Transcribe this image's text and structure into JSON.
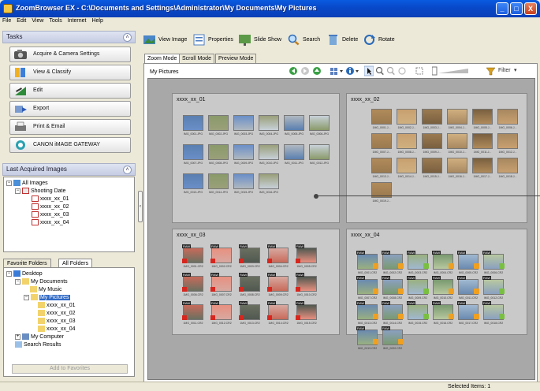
{
  "window": {
    "title": "ZoomBrowser EX  -  C:\\Documents and Settings\\Administrator\\My Documents\\My Pictures",
    "min": "_",
    "max": "□",
    "close": "X"
  },
  "menu": [
    "File",
    "Edit",
    "View",
    "Tools",
    "Internet",
    "Help"
  ],
  "tasks": {
    "header": "Tasks",
    "items": [
      "Acquire & Camera Settings",
      "View & Classify",
      "Edit",
      "Export",
      "Print & Email",
      "CANON iMAGE GATEWAY"
    ]
  },
  "last_acquired": {
    "header": "Last Acquired Images",
    "root": "All Images",
    "group": "Shooting Date",
    "folders": [
      "xxxx_xx_01",
      "xxxx_xx_02",
      "xxxx_xx_03",
      "xxxx_xx_04"
    ]
  },
  "favorites": {
    "tabs": [
      "Favorite Folders",
      "All Folders"
    ],
    "desktop": "Desktop",
    "my_documents": "My Documents",
    "my_music": "My Music",
    "my_pictures": "My Pictures",
    "folders": [
      "xxxx_xx_01",
      "xxxx_xx_02",
      "xxxx_xx_03",
      "xxxx_xx_04"
    ],
    "my_computer": "My Computer",
    "search_results": "Search Results",
    "add_button": "Add to Favorites"
  },
  "toolbar": [
    "View Image",
    "Properties",
    "Slide Show",
    "Search",
    "Delete",
    "Rotate"
  ],
  "view_tabs": [
    "Zoom Mode",
    "Scroll Mode",
    "Preview Mode"
  ],
  "breadcrumb": "My Pictures",
  "filter_label": "Filter",
  "groups": [
    {
      "label": "xxxx_xx_01",
      "captions": [
        "IMG_0001.JPG",
        "IMG_0002.JPG",
        "IMG_0003.JPG",
        "IMG_0004.JPG",
        "IMG_0005.JPG",
        "IMG_0006.JPG",
        "IMG_0007.JPG",
        "IMG_0008.JPG",
        "IMG_0009.JPG",
        "IMG_0010.JPG",
        "IMG_0011.JPG",
        "IMG_0012.JPG",
        "IMG_0013.JPG",
        "IMG_0014.JPG",
        "IMG_0015.JPG",
        "IMG_0016.JPG"
      ]
    },
    {
      "label": "xxxx_xx_02",
      "captions": [
        "1MG_0001.J...",
        "1MG_0002.J...",
        "1MG_0003.J...",
        "1MG_0004.J...",
        "1MG_0005.J...",
        "1MG_0006.J...",
        "1MG_0007.J...",
        "1MG_0008.J...",
        "1MG_0009.J...",
        "1MG_0010.J...",
        "1MG_0011.J...",
        "1MG_0012.J...",
        "1MG_0013.J...",
        "1MG_0014.J...",
        "1MG_0015.J...",
        "1MG_0016.J...",
        "1MG_0017.J...",
        "1MG_0018.J...",
        "1MG_0019.J..."
      ]
    },
    {
      "label": "xxxx_xx_03",
      "captions": [
        "1MG_0001.CR2",
        "1MG_0002.CR2",
        "1MG_0003.CR2",
        "1MG_0004.CR2",
        "1MG_0005.CR2",
        "1MG_0006.CR2",
        "1MG_0007.CR2",
        "1MG_0008.CR2",
        "1MG_0009.CR2",
        "1MG_0010.CR2",
        "1MG_0011.CR2",
        "1MG_0012.CR2",
        "1MG_0013.CR2",
        "1MG_0014.CR2",
        "1MG_0015.CR2"
      ]
    },
    {
      "label": "xxxx_xx_04",
      "captions": [
        "IMG_0001.CR2",
        "IMG_0002.CR2",
        "IMG_0003.CR2",
        "IMG_0004.CR2",
        "IMG_0005.CR2",
        "IMG_0006.CR2",
        "IMG_0007.CR2",
        "IMG_0008.CR2",
        "IMG_0009.CR2",
        "IMG_0010.CR2",
        "IMG_0011.CR2",
        "IMG_0012.CR2",
        "IMG_0013.CR2",
        "IMG_0014.CR2",
        "IMG_0015.CR2",
        "IMG_0016.CR2",
        "IMG_0017.CR2",
        "IMG_0018.CR2",
        "IMG_0019.CR2",
        "IMG_0020.CR2"
      ]
    }
  ],
  "raw_label": "RAW",
  "status": {
    "selected": "Selected Items: 1"
  }
}
